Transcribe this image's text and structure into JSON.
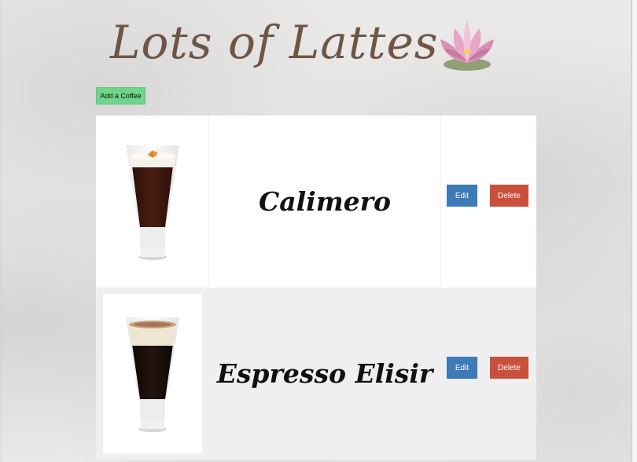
{
  "header": {
    "title": "Lots of Lattes",
    "logo_icon": "lotus-flower-icon"
  },
  "toolbar": {
    "add_label": "Add a Coffee"
  },
  "coffees": [
    {
      "name": "Calimero",
      "edit_label": "Edit",
      "delete_label": "Delete",
      "image_icon": "glass-coffee-icon"
    },
    {
      "name": "Espresso Elisir",
      "edit_label": "Edit",
      "delete_label": "Delete",
      "image_icon": "glass-coffee-icon"
    }
  ],
  "colors": {
    "add_button": "#6fd58a",
    "edit_button": "#3d7ab8",
    "delete_button": "#c9503c",
    "title": "#6e5544"
  }
}
